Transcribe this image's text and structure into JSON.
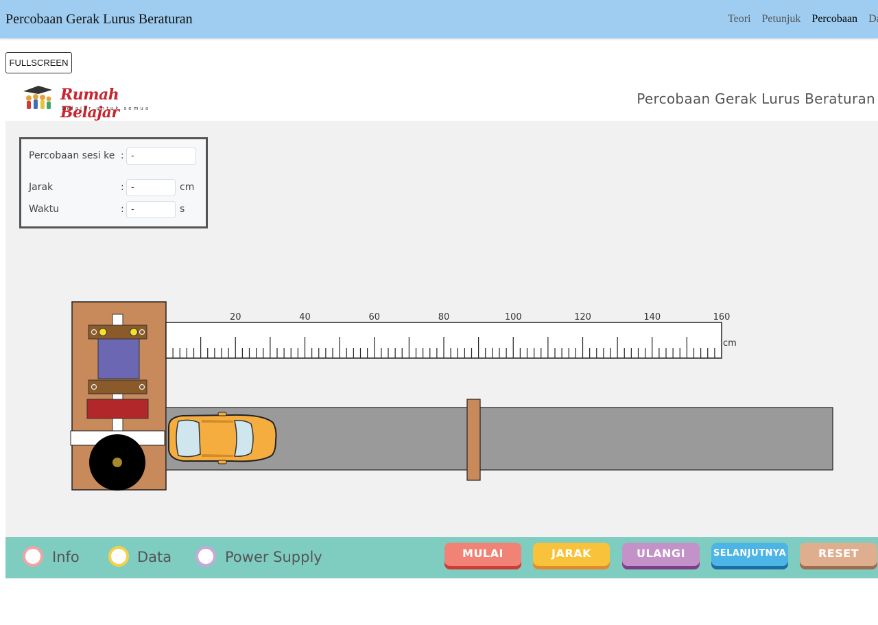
{
  "navbar": {
    "title": "Percobaan Gerak Lurus Beraturan",
    "links": [
      "Teori",
      "Petunjuk",
      "Percobaan",
      "Data"
    ]
  },
  "fullscreen_label": "FULLSCREEN",
  "app": {
    "logo_title": "Rumah Belajar",
    "logo_tagline": "belajar untuk semua",
    "title": "Percobaan Gerak Lurus Beraturan"
  },
  "panel": {
    "sesi_label": "Percobaan sesi ke",
    "sesi_value": "-",
    "jarak_label": "Jarak",
    "jarak_value": "-",
    "jarak_unit": "cm",
    "waktu_label": "Waktu",
    "waktu_value": "-",
    "waktu_unit": "s",
    "colon": ":"
  },
  "ruler": {
    "labels": [
      "20",
      "40",
      "60",
      "80",
      "100",
      "120",
      "140",
      "160"
    ],
    "unit": "cm"
  },
  "bottombar": {
    "checkboxes": [
      {
        "label": "Info",
        "color": "#f2a3a3"
      },
      {
        "label": "Data",
        "color": "#f7d04a"
      },
      {
        "label": "Power Supply",
        "color": "#c9a7d6"
      }
    ],
    "buttons": [
      {
        "label": "MULAI",
        "color": "#f08276",
        "shadow": "#d23a36"
      },
      {
        "label": "JARAK",
        "color": "#f8c23a",
        "shadow": "#e38b2a"
      },
      {
        "label": "ULANGI",
        "color": "#c392c8",
        "shadow": "#7f3d87"
      },
      {
        "label": "SELANJUTNYA",
        "color": "#4cb5e6",
        "shadow": "#1d6ca6"
      },
      {
        "label": "RESET",
        "color": "#dfae8e",
        "shadow": "#9e6c4e"
      }
    ]
  }
}
